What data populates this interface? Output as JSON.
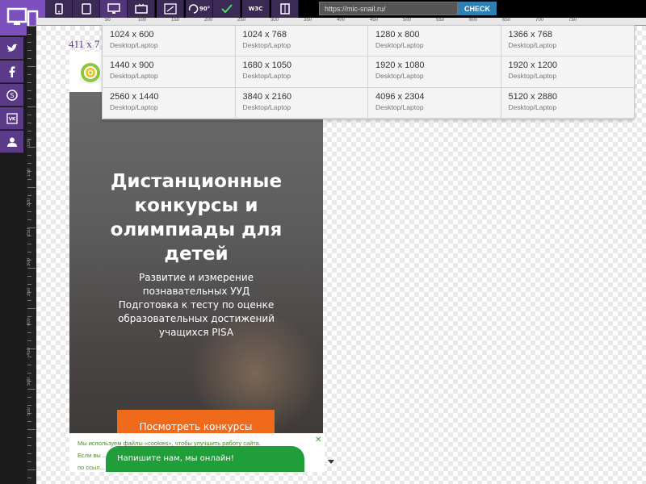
{
  "toolbar": {
    "url_value": "https://mic-snail.ru/",
    "check_label": "CHECK",
    "buttons": [
      {
        "name": "device-mobile-button",
        "icon": "phone-icon"
      },
      {
        "name": "device-tablet-button",
        "icon": "tablet-icon"
      },
      {
        "name": "device-desktop-button",
        "icon": "monitor-icon"
      },
      {
        "name": "device-tv-button",
        "icon": "tv-icon"
      },
      {
        "name": "resize-button",
        "icon": "resize-icon"
      },
      {
        "name": "rotate-button",
        "icon": "rotate-icon",
        "text": "90°"
      },
      {
        "name": "validate-css-button",
        "icon": "check-css-icon"
      },
      {
        "name": "validate-w3c-button",
        "icon": "w3c-icon",
        "text": "W3C"
      },
      {
        "name": "bookmark-button",
        "icon": "book-icon"
      }
    ]
  },
  "social": [
    "twitter-icon",
    "facebook-icon",
    "skype-icon",
    "vk-icon",
    "user-icon"
  ],
  "ruler": {
    "top_ticks": [
      "50",
      "100",
      "150",
      "200",
      "250",
      "300",
      "350",
      "400",
      "450",
      "500",
      "550",
      "600",
      "650",
      "700",
      "750"
    ],
    "left_ticks": [
      "100",
      "150",
      "200",
      "250",
      "300",
      "350",
      "400",
      "450",
      "500",
      "550"
    ]
  },
  "viewport": {
    "size_label": "411 x 7"
  },
  "resolutions": [
    {
      "size": "1024 x 600",
      "type": "Desktop/Laptop"
    },
    {
      "size": "1024 x 768",
      "type": "Desktop/Laptop"
    },
    {
      "size": "1280 x 800",
      "type": "Desktop/Laptop"
    },
    {
      "size": "1366 x 768",
      "type": "Desktop/Laptop"
    },
    {
      "size": "1440 x 900",
      "type": "Desktop/Laptop"
    },
    {
      "size": "1680 x 1050",
      "type": "Desktop/Laptop"
    },
    {
      "size": "1920 x 1080",
      "type": "Desktop/Laptop"
    },
    {
      "size": "1920 x 1200",
      "type": "Desktop/Laptop"
    },
    {
      "size": "2560 x 1440",
      "type": "Desktop/Laptop"
    },
    {
      "size": "3840 x 2160",
      "type": "Desktop/Laptop"
    },
    {
      "size": "4096 x 2304",
      "type": "Desktop/Laptop"
    },
    {
      "size": "5120 x 2880",
      "type": "Desktop/Laptop"
    }
  ],
  "site": {
    "hero_title": "Дистанционные конкурсы и олимпиады для детей",
    "hero_subtitle_lines": [
      "Развитие и измерение",
      "познавательных УУД",
      "Подготовка к тесту по оценке",
      "образовательных достижений",
      "учащихся PISA"
    ],
    "cta_label": "Посмотреть конкурсы",
    "cookie_lines": [
      "Мы используем файлы «cookies», чтобы улучшить работу сайта.",
      "Если вы ... сайте",
      "по ссыл..."
    ],
    "chat_label": "Напишите нам, мы онлайн!"
  },
  "colors": {
    "accent_purple": "#7b4fbe",
    "check_blue": "#2f7fb3",
    "cta_orange": "#f06a1c",
    "chat_green": "#1f9e3a"
  }
}
